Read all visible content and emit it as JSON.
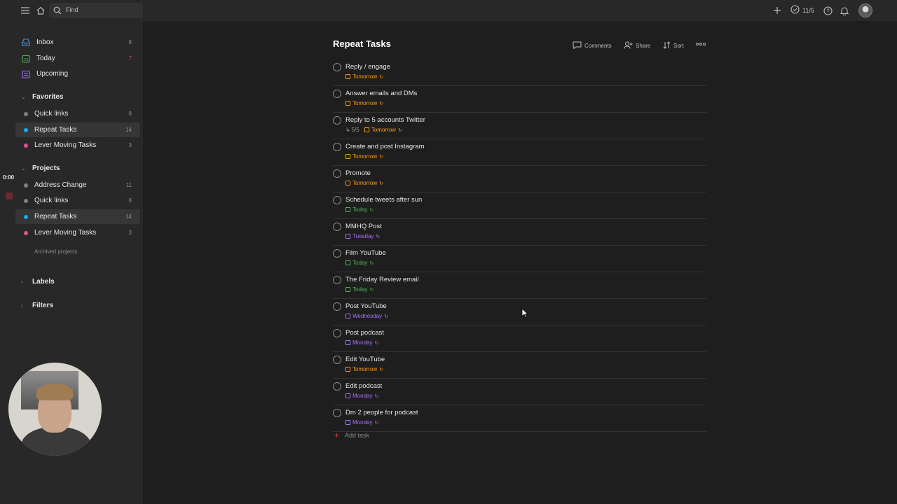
{
  "topbar": {
    "search_placeholder": "Find",
    "karma": "11/5",
    "icons": [
      "menu-icon",
      "home-icon",
      "search-icon",
      "plus-icon",
      "check-circle-icon",
      "help-icon",
      "bell-icon"
    ]
  },
  "sidebar": {
    "top_items": [
      {
        "label": "Inbox",
        "count": "8",
        "color": "#4a90d9"
      },
      {
        "label": "Today",
        "count": "7",
        "color": "#4fb34f",
        "count_color": "#d0453a"
      },
      {
        "label": "Upcoming",
        "count": "",
        "color": "#a970ff"
      }
    ],
    "favorites": {
      "heading": "Favorites",
      "items": [
        {
          "label": "Quick links",
          "count": "8",
          "color": "#808080"
        },
        {
          "label": "Repeat Tasks",
          "count": "14",
          "color": "#14aaf5"
        },
        {
          "label": "Lever Moving Tasks",
          "count": "3",
          "color": "#e05194"
        }
      ]
    },
    "projects": {
      "heading": "Projects",
      "items": [
        {
          "label": "Address Change",
          "count": "11",
          "color": "#808080"
        },
        {
          "label": "Quick links",
          "count": "8",
          "color": "#808080"
        },
        {
          "label": "Repeat Tasks",
          "count": "14",
          "color": "#14aaf5"
        },
        {
          "label": "Lever Moving Tasks",
          "count": "3",
          "color": "#e05194"
        }
      ],
      "archived_label": "Archived projects"
    },
    "labels_heading": "Labels",
    "filters_heading": "Filters"
  },
  "overlay": {
    "timer": "0:00"
  },
  "main": {
    "title": "Repeat Tasks",
    "actions": {
      "comments": "Comments",
      "share": "Share",
      "sort": "Sort"
    },
    "colors": {
      "tomorrow": "#ff9a14",
      "today": "#4fb34f",
      "weekday": "#a970ff"
    },
    "tasks": [
      {
        "name": "Reply / engage",
        "due": "Tomorrow",
        "kind": "tomorrow"
      },
      {
        "name": "Answer emails and DMs",
        "due": "Tomorrow",
        "kind": "tomorrow"
      },
      {
        "name": "Reply to 5 accounts Twitter",
        "due": "Tomorrow",
        "kind": "tomorrow",
        "subtasks": "5/5"
      },
      {
        "name": "Create and post Instagram",
        "due": "Tomorrow",
        "kind": "tomorrow"
      },
      {
        "name": "Promote",
        "due": "Tomorrow",
        "kind": "tomorrow"
      },
      {
        "name": "Schedule tweets after sun",
        "due": "Today",
        "kind": "today"
      },
      {
        "name": "MMHQ Post",
        "due": "Tuesday",
        "kind": "weekday"
      },
      {
        "name": "Film YouTube",
        "due": "Today",
        "kind": "today"
      },
      {
        "name": "The Friday Review email",
        "due": "Today",
        "kind": "today"
      },
      {
        "name": "Post YouTube",
        "due": "Wednesday",
        "kind": "weekday"
      },
      {
        "name": "Post podcast",
        "due": "Monday",
        "kind": "weekday"
      },
      {
        "name": "Edit YouTube",
        "due": "Tomorrow",
        "kind": "tomorrow"
      },
      {
        "name": "Edit podcast",
        "due": "Monday",
        "kind": "weekday"
      },
      {
        "name": "Dm 2 people for podcast",
        "due": "Monday",
        "kind": "weekday"
      }
    ],
    "add_task_label": "Add task"
  }
}
